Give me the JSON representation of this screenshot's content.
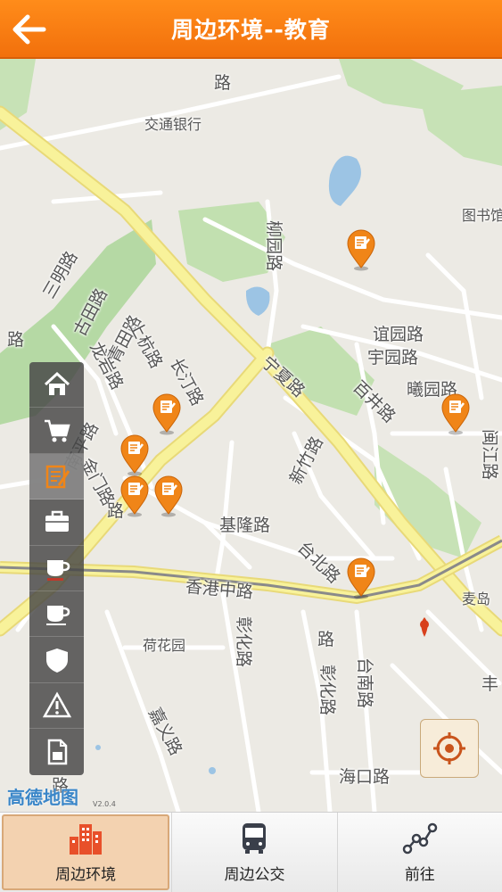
{
  "header": {
    "title": "周边环境--教育"
  },
  "map": {
    "labels": [
      "三明路",
      "古田路",
      "青田路",
      "上杭路",
      "龙岩路",
      "长汀路",
      "南平路",
      "金门路",
      "柳园路",
      "宁夏路",
      "谊园路",
      "宇园路",
      "曦园路",
      "百井路",
      "新竹路",
      "基隆路",
      "台北路",
      "香港中路",
      "彰化路",
      "嘉义路",
      "台南路",
      "彰化路",
      "海口路",
      "麦岛",
      "图书馆",
      "交通银行",
      "荷花园",
      "路",
      "路",
      "路",
      "路",
      "路",
      "闽江路",
      "丰"
    ],
    "logo": "高德地图",
    "version": "V2.0.4"
  },
  "sidebar": {
    "items": [
      {
        "icon": "home-icon",
        "active": false
      },
      {
        "icon": "shopping-cart-icon",
        "active": false
      },
      {
        "icon": "education-icon",
        "active": true
      },
      {
        "icon": "briefcase-icon",
        "active": false
      },
      {
        "icon": "restaurant-icon",
        "active": false
      },
      {
        "icon": "coffee-cup-icon",
        "active": false
      },
      {
        "icon": "shield-icon",
        "active": false
      },
      {
        "icon": "warning-icon",
        "active": false
      },
      {
        "icon": "document-icon",
        "active": false
      }
    ]
  },
  "bottom_nav": {
    "tabs": [
      {
        "label": "周边环境",
        "icon": "buildings-icon",
        "active": true
      },
      {
        "label": "周边公交",
        "icon": "bus-icon",
        "active": false
      },
      {
        "label": "前往",
        "icon": "route-icon",
        "active": false
      }
    ]
  },
  "colors": {
    "header": "#f47a12",
    "pin": "#f08518",
    "road_major": "#f6ef8a",
    "green": "#b5d9a4",
    "water": "#9cc4e4"
  }
}
